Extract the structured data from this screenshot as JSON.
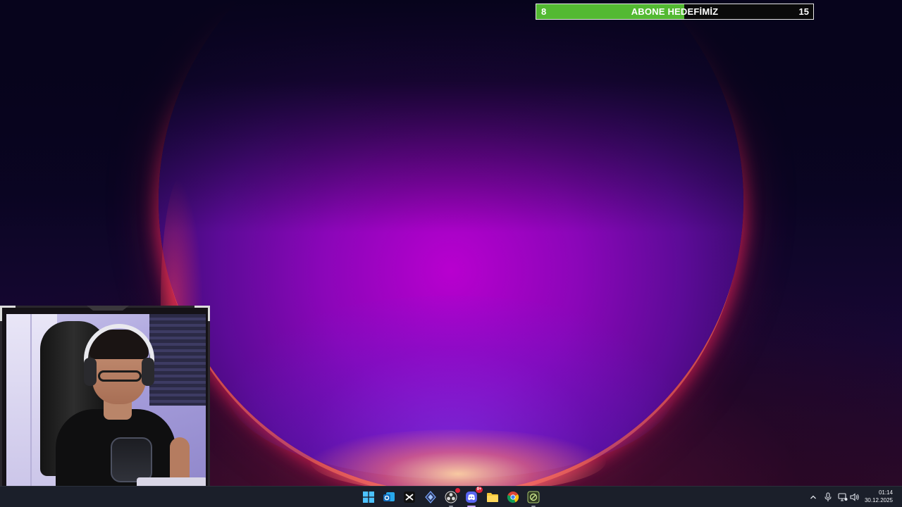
{
  "goal": {
    "title": "ABONE HEDEFİMİZ",
    "current": "8",
    "target": "15",
    "progress_fraction": 0.5333,
    "fill_color": "#53b932"
  },
  "webcam": {
    "description_icon": "webcam-feed"
  },
  "taskbar": {
    "icons": [
      {
        "name": "windows-start-icon",
        "active": false
      },
      {
        "name": "outlook-icon",
        "active": false
      },
      {
        "name": "capcut-icon",
        "active": false
      },
      {
        "name": "codex-app-icon",
        "active": false
      },
      {
        "name": "obs-icon",
        "active": false,
        "badge": "red-dot"
      },
      {
        "name": "discord-icon",
        "active": true,
        "badge_text": "9+"
      },
      {
        "name": "file-explorer-icon",
        "active": false
      },
      {
        "name": "chrome-icon",
        "active": false
      },
      {
        "name": "app-green-icon",
        "active": false
      }
    ],
    "tray": {
      "chevron_up_icon": "chevron-up-icon",
      "mic_icon": "microphone-icon",
      "network_icon": "network-icon",
      "volume_icon": "volume-icon"
    },
    "clock": {
      "time": "01:14",
      "date": "30.12.2025"
    }
  }
}
